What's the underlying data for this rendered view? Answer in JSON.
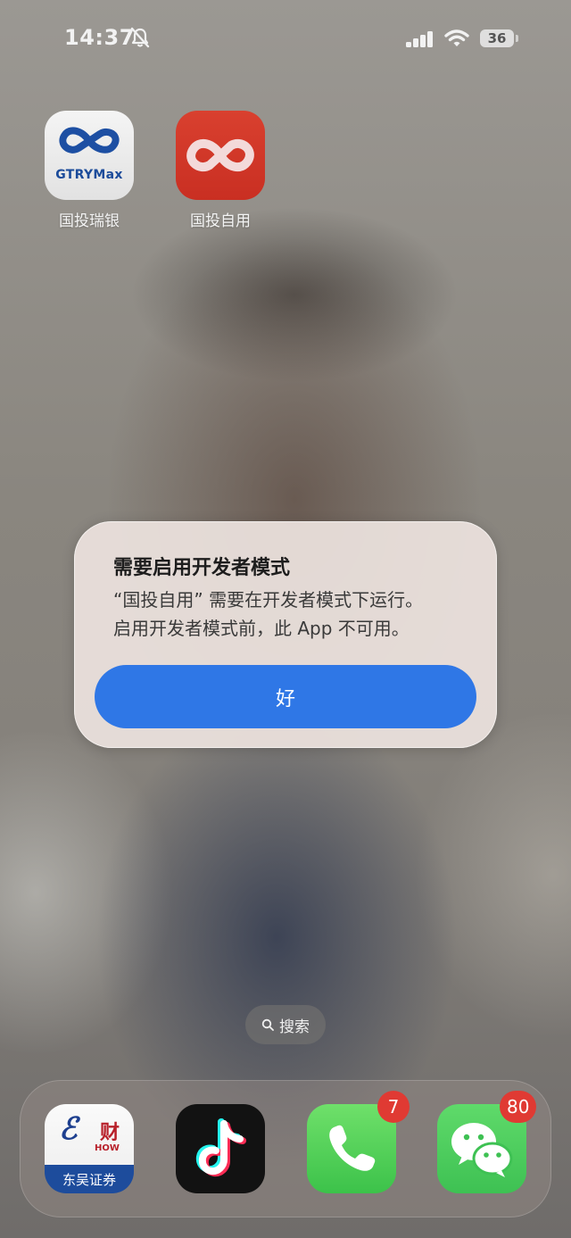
{
  "status_bar": {
    "time": "14:37",
    "battery": "36",
    "icons": [
      "bell-slash-icon",
      "cellular-signal-icon",
      "wifi-icon",
      "battery-icon"
    ]
  },
  "home_apps": [
    {
      "label": "国投瑞银",
      "icon_text": "GTRYMax",
      "icon": "gtrymax-icon"
    },
    {
      "label": "国投自用",
      "icon": "guotou-ziyong-icon"
    }
  ],
  "alert": {
    "title": "需要启用开发者模式",
    "message_line1": "“国投自用” 需要在开发者模式下运行。",
    "message_line2": "启用开发者模式前，此 App 不可用。",
    "button_label": "好",
    "button_color": "#2f77e6"
  },
  "search": {
    "label": "搜索",
    "icon": "search-icon"
  },
  "dock": {
    "apps": [
      {
        "name": "东吴证券",
        "icon": "dongwu-securities-icon",
        "icon_text": "东吴证券",
        "icon_mark": "财",
        "icon_sub": "HOW"
      },
      {
        "name": "TikTok",
        "icon": "tiktok-icon"
      },
      {
        "name": "Phone",
        "icon": "phone-icon",
        "badge": "7"
      },
      {
        "name": "WeChat",
        "icon": "wechat-icon",
        "badge": "80"
      }
    ],
    "badge_color": "#e03a33"
  }
}
